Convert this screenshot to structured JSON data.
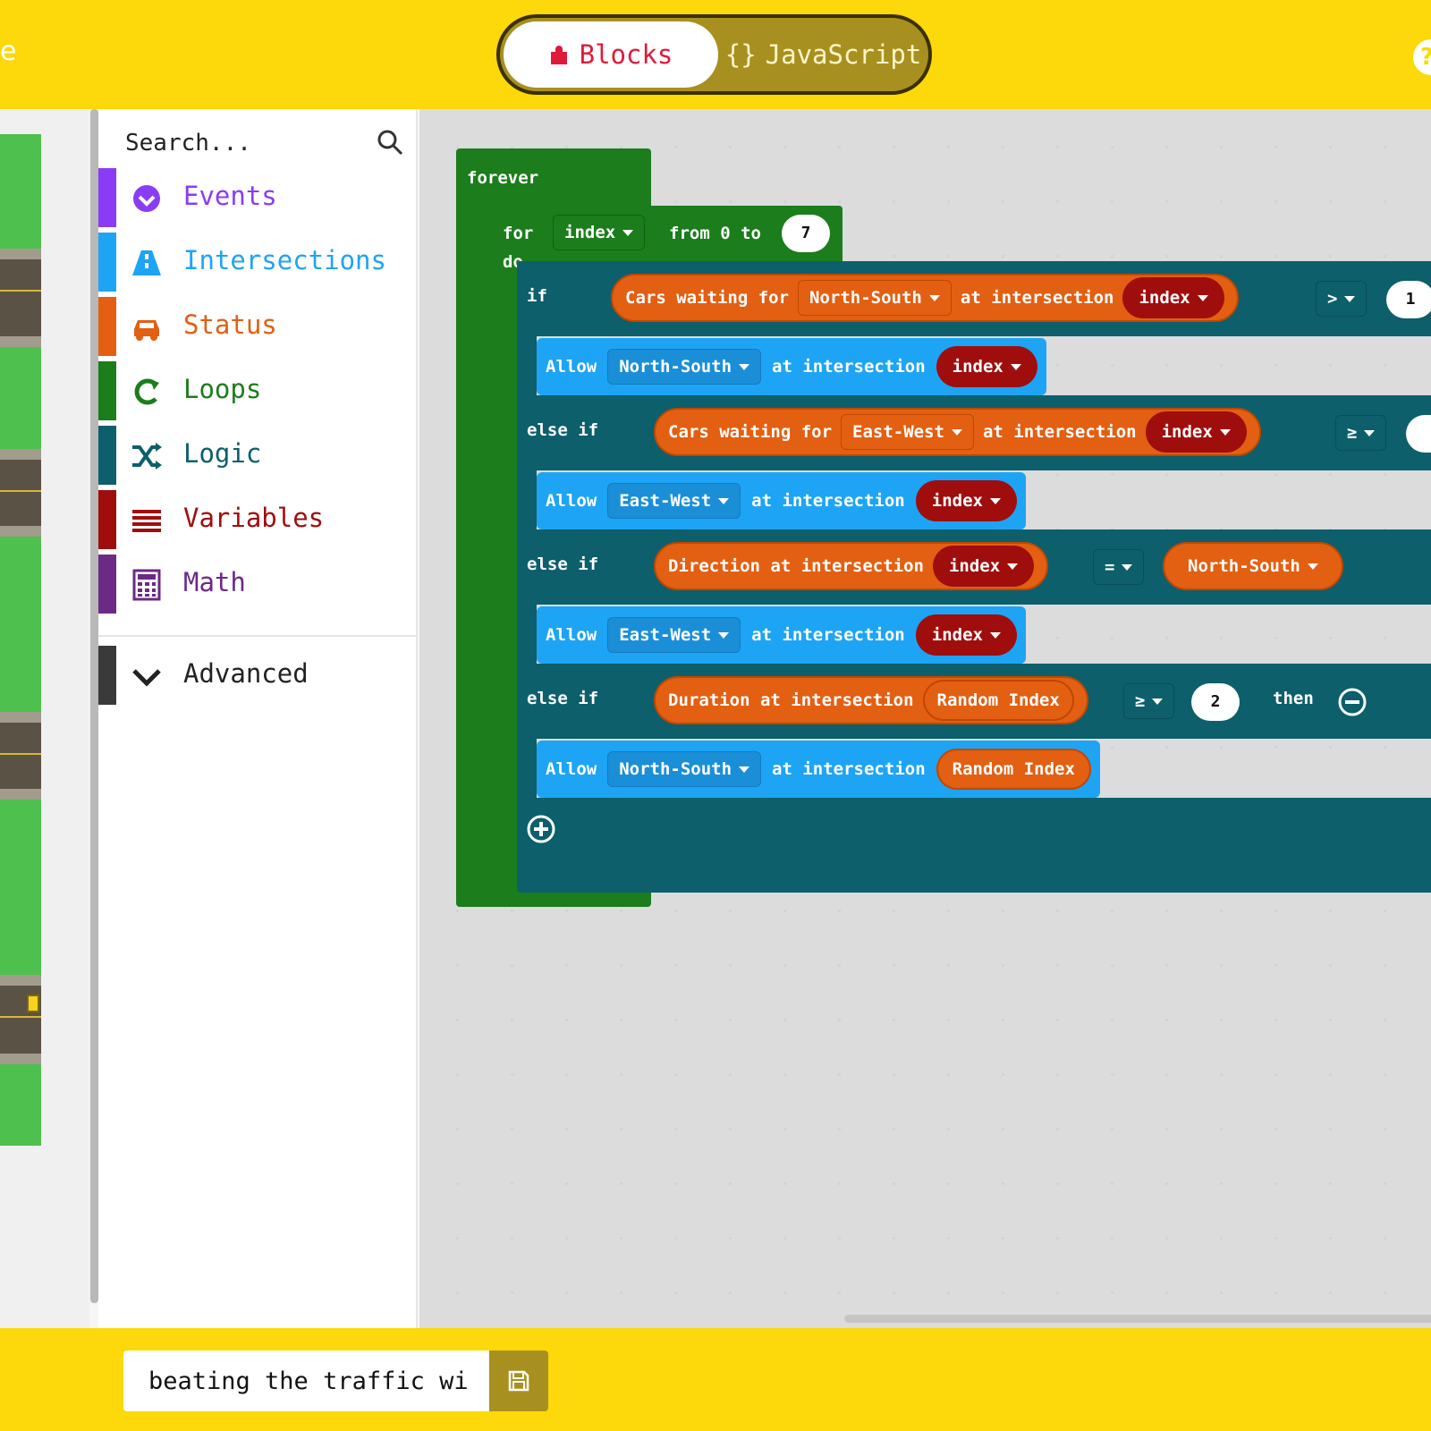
{
  "app": {
    "title_fragment": "e"
  },
  "header": {
    "tabs": [
      {
        "label": "Blocks",
        "icon": "puzzle-icon",
        "active": true
      },
      {
        "label": "JavaScript",
        "icon": "braces-icon",
        "active": false
      }
    ],
    "js_braces": "{}",
    "help_label": "?"
  },
  "toolbox": {
    "search_placeholder": "Search...",
    "categories": [
      {
        "label": "Events",
        "color": "#8a3cf5",
        "icon": "check-circle-icon"
      },
      {
        "label": "Intersections",
        "color": "#1ea4f4",
        "icon": "road-icon"
      },
      {
        "label": "Status",
        "color": "#e35f12",
        "icon": "car-icon"
      },
      {
        "label": "Loops",
        "color": "#1b7d1b",
        "icon": "loop-arrow-icon"
      },
      {
        "label": "Logic",
        "color": "#0c5f6b",
        "icon": "shuffle-icon"
      },
      {
        "label": "Variables",
        "color": "#a00d0d",
        "icon": "lines-icon"
      },
      {
        "label": "Math",
        "color": "#6b2a86",
        "icon": "calculator-icon"
      }
    ],
    "advanced": {
      "label": "Advanced",
      "color": "#3a3a3a",
      "icon": "chevron-down-icon"
    }
  },
  "workspace": {
    "forever": "forever",
    "for_loop": {
      "for": "for",
      "var": "index",
      "from": "from 0 to",
      "to": "7",
      "do": "do"
    },
    "if_block": {
      "kw_if": "if",
      "kw_else_if": "else if",
      "kw_then": "then",
      "cond1": {
        "text1": "Cars waiting for",
        "dir": "North-South",
        "text2": "at intersection",
        "var": "index",
        "op": ">",
        "value": "1"
      },
      "cond2": {
        "text1": "Cars waiting for",
        "dir": "East-West",
        "text2": "at intersection",
        "var": "index",
        "op": "≥"
      },
      "cond3": {
        "text1": "Direction at intersection",
        "var": "index",
        "op": "=",
        "dir": "North-South"
      },
      "cond4": {
        "text1": "Duration at intersection",
        "var": "Random Index",
        "op": "≥",
        "value": "2"
      },
      "allow1": {
        "kw": "Allow",
        "dir": "North-South",
        "text": "at intersection",
        "var": "index"
      },
      "allow2": {
        "kw": "Allow",
        "dir": "East-West",
        "text": "at intersection",
        "var": "index"
      },
      "allow3": {
        "kw": "Allow",
        "dir": "East-West",
        "text": "at intersection",
        "var": "index"
      },
      "allow4": {
        "kw": "Allow",
        "dir": "North-South",
        "text": "at intersection",
        "var": "Random Index"
      }
    }
  },
  "footer": {
    "project_name": "beating the traffic wi",
    "save_icon": "save-icon"
  },
  "colors": {
    "brand_yellow": "#fdd80a",
    "loops": "#1b7d1b",
    "logic": "#0c5f6b",
    "intersections": "#1ea4f4",
    "status": "#e35f12",
    "variables": "#a00d0d"
  }
}
